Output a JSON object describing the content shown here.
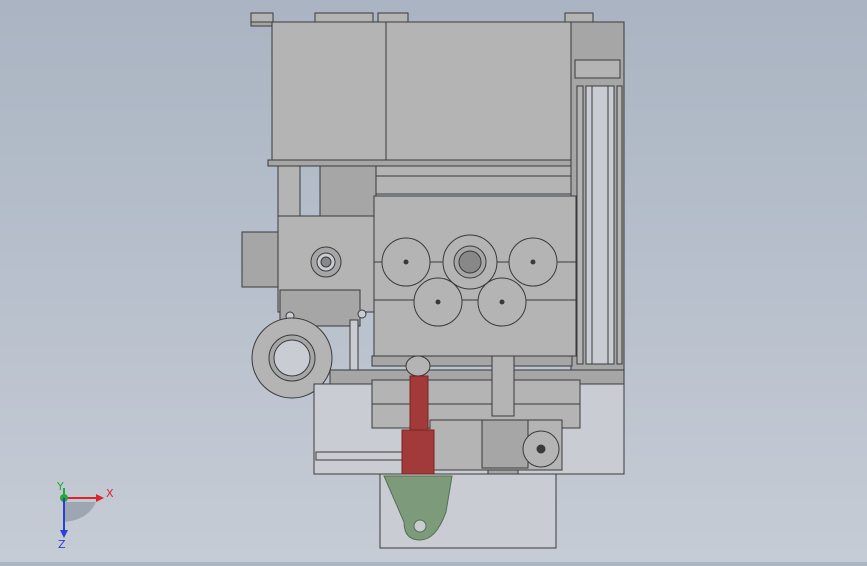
{
  "viewport": {
    "colors": {
      "background_top": "#aab4c2",
      "background_bottom": "#c6ccd5",
      "body_fill": "#b4b4b4",
      "body_fill_dark": "#a6a6a6",
      "glass_fill": "#c9cdd3",
      "edge": "#3a3a3a",
      "red_part": "#a33a3a",
      "red_dark": "#7a2424",
      "green_part": "#7d9a7a",
      "green_dark": "#566f55"
    }
  },
  "triad": {
    "x_label": "X",
    "y_label": "Y",
    "z_label": "Z",
    "x_color": "#e0232b",
    "y_color": "#27a83b",
    "z_color": "#2a3fd6"
  }
}
